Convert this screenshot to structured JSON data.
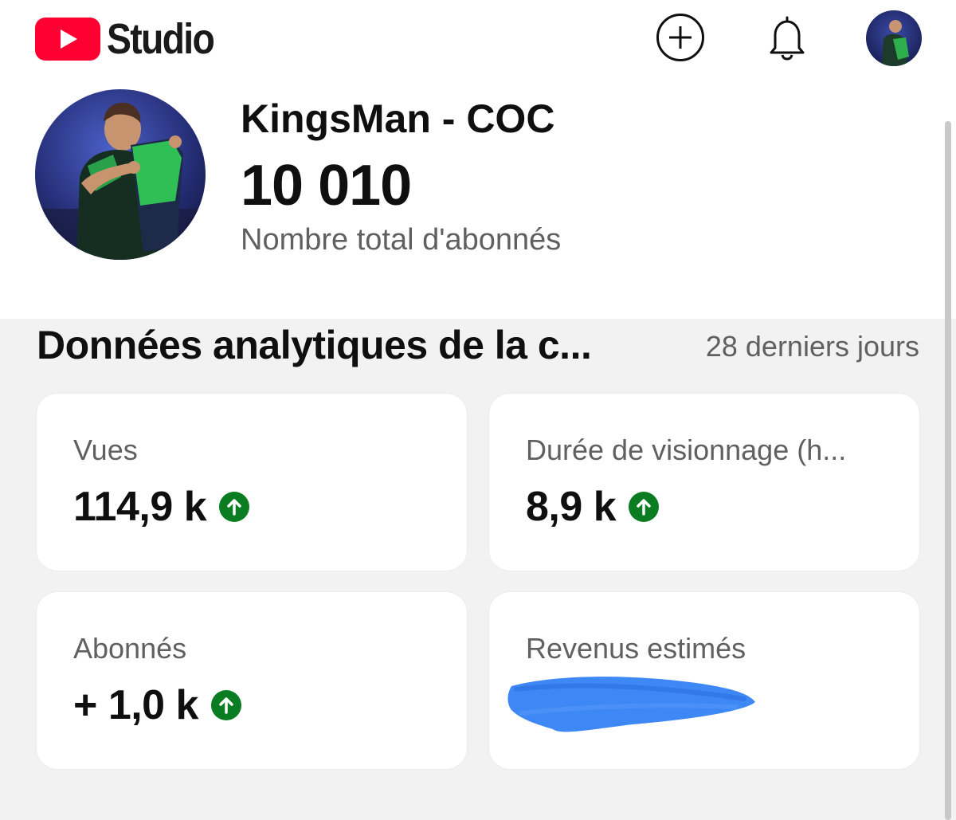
{
  "header": {
    "app_name": "Studio",
    "logo_icon": "youtube-play-icon",
    "brand_color": "#ff0033",
    "add_icon": "plus-circle-icon",
    "bell_icon": "bell-icon"
  },
  "channel": {
    "name": "KingsMan - COC",
    "subscriber_count": "10 010",
    "subscriber_label": "Nombre total d'abonnés"
  },
  "analytics": {
    "title": "Données analytiques de la c...",
    "period": "28 derniers jours",
    "trend_color": "#0a7c21",
    "cards": [
      {
        "label": "Vues",
        "value": "114,9 k",
        "trend": "up"
      },
      {
        "label": "Durée de visionnage (h...",
        "value": "8,9 k",
        "trend": "up"
      },
      {
        "label": "Abonnés",
        "value": "+ 1,0 k",
        "trend": "up"
      },
      {
        "label": "Revenus estimés",
        "value": "",
        "trend": "redacted",
        "redaction_color": "#3d88f5"
      }
    ]
  }
}
